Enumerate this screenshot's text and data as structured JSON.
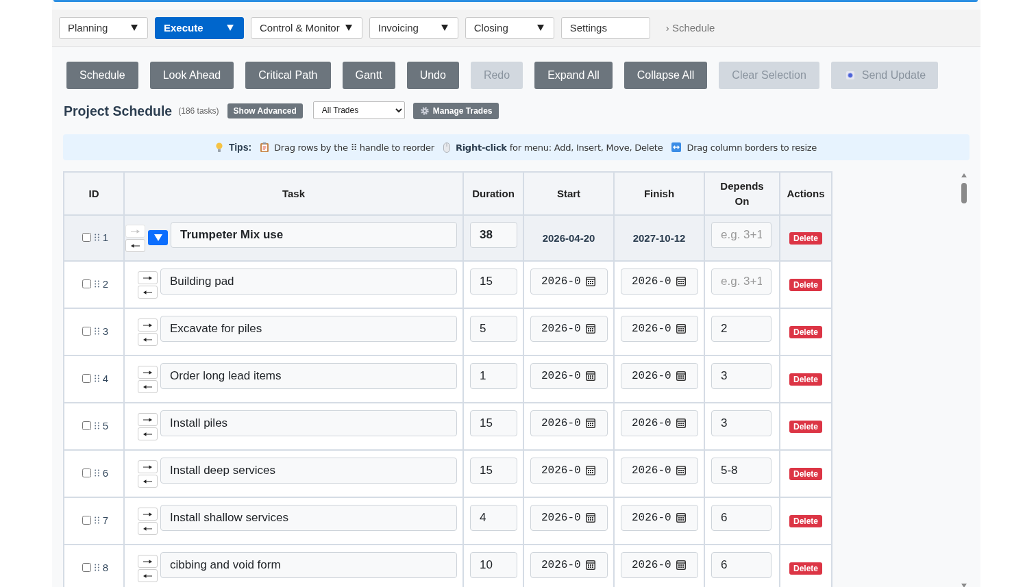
{
  "nav": {
    "items": [
      {
        "label": "Planning",
        "dropdown": true,
        "selected": false
      },
      {
        "label": "Execute",
        "dropdown": true,
        "selected": true
      },
      {
        "label": "Control & Monitor",
        "dropdown": true,
        "selected": false
      },
      {
        "label": "Invoicing",
        "dropdown": true,
        "selected": false
      },
      {
        "label": "Closing",
        "dropdown": true,
        "selected": false
      },
      {
        "label": "Settings",
        "dropdown": false,
        "selected": false
      }
    ],
    "breadcrumb": "› Schedule"
  },
  "toolbar": [
    {
      "label": "Schedule",
      "kind": "text",
      "disabled": false
    },
    {
      "label": "Look Ahead",
      "kind": "text",
      "disabled": false
    },
    {
      "label": "Critical Path",
      "kind": "text",
      "disabled": false
    },
    {
      "label": "Gantt",
      "kind": "text",
      "disabled": false
    },
    {
      "label": "Undo",
      "kind": "text",
      "disabled": false
    },
    {
      "label": "Redo",
      "kind": "text",
      "disabled": true
    },
    {
      "label": "Expand All",
      "kind": "text",
      "disabled": false
    },
    {
      "label": "Collapse All",
      "kind": "text",
      "disabled": false
    },
    {
      "label": "Clear Selection",
      "kind": "text",
      "disabled": true
    },
    {
      "label": "Send Update",
      "kind": "icon-text",
      "disabled": true
    }
  ],
  "header": {
    "title": "Project Schedule",
    "task_count": "(186 tasks)",
    "advanced_button": "Show Advanced",
    "trade_filter": "All Trades",
    "manage_button": "Manage Trades"
  },
  "tips": {
    "label": "Tips:",
    "items": [
      {
        "kind": "reorder",
        "text": "Drag rows by the ⠿ handle to reorder"
      },
      {
        "kind": "menu",
        "text": "**Right-click** for menu: Add, Insert, Move, Delete"
      },
      {
        "kind": "resize",
        "text": "Drag column borders to resize"
      }
    ]
  },
  "table": {
    "columns": [
      "ID",
      "Task",
      "Duration",
      "Start",
      "Finish",
      "Depends On",
      "Actions"
    ],
    "rows": [
      {
        "id": "1",
        "checked": false,
        "kind": "summary",
        "expanded": true,
        "indent_disabled": true,
        "task": "Trumpeter Mix use",
        "duration": "38",
        "start": "2026-04-20",
        "finish": "2027-10-12",
        "depends_placeholder": "e.g. 3+1",
        "action": "Delete",
        "children": [
          {
            "id": "2",
            "checked": false,
            "kind": "task",
            "indent_disabled": false,
            "task": "Building pad",
            "duration": "15",
            "start": "2026-0",
            "finish": "2026-0",
            "depends_placeholder": "e.g. 3+1",
            "action": "Delete"
          },
          {
            "id": "3",
            "checked": false,
            "kind": "task",
            "indent_disabled": false,
            "task": "Excavate for piles",
            "duration": "5",
            "start": "2026-0",
            "finish": "2026-0",
            "depends": "2",
            "action": "Delete"
          },
          {
            "id": "4",
            "checked": false,
            "kind": "task",
            "indent_disabled": false,
            "task": "Order long lead items",
            "duration": "1",
            "start": "2026-0",
            "finish": "2026-0",
            "depends": "3",
            "action": "Delete"
          },
          {
            "id": "5",
            "checked": false,
            "kind": "task",
            "indent_disabled": false,
            "task": "Install piles",
            "duration": "15",
            "start": "2026-0",
            "finish": "2026-0",
            "depends": "3",
            "action": "Delete"
          },
          {
            "id": "6",
            "checked": false,
            "kind": "task",
            "indent_disabled": false,
            "task": "Install deep services",
            "duration": "15",
            "start": "2026-0",
            "finish": "2026-0",
            "depends": "5-8",
            "action": "Delete"
          },
          {
            "id": "7",
            "checked": false,
            "kind": "task",
            "indent_disabled": false,
            "task": "Install shallow services",
            "duration": "4",
            "start": "2026-0",
            "finish": "2026-0",
            "depends": "6",
            "action": "Delete"
          },
          {
            "id": "8",
            "checked": false,
            "kind": "task",
            "indent_disabled": false,
            "task": "cibbing and void form",
            "duration": "10",
            "start": "2026-0",
            "finish": "2026-0",
            "depends": "6",
            "action": "Delete"
          }
        ]
      }
    ]
  }
}
